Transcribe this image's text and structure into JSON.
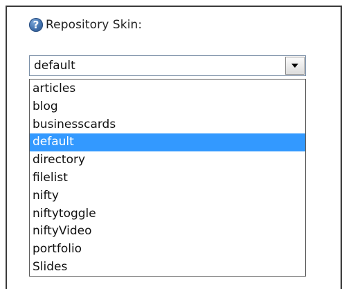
{
  "field": {
    "label": "Repository Skin:",
    "help_icon": "help-icon",
    "help_glyph": "?"
  },
  "select": {
    "value": "default",
    "arrow_icon": "chevron-down-icon"
  },
  "options": [
    {
      "label": "articles",
      "selected": false
    },
    {
      "label": "blog",
      "selected": false
    },
    {
      "label": "businesscards",
      "selected": false
    },
    {
      "label": "default",
      "selected": true
    },
    {
      "label": "directory",
      "selected": false
    },
    {
      "label": "filelist",
      "selected": false
    },
    {
      "label": "nifty",
      "selected": false
    },
    {
      "label": "niftytoggle",
      "selected": false
    },
    {
      "label": "niftyVideo",
      "selected": false
    },
    {
      "label": "portfolio",
      "selected": false
    },
    {
      "label": "Slides",
      "selected": false
    }
  ],
  "colors": {
    "selection": "#3399ff",
    "help_icon": "#3f6fab"
  }
}
